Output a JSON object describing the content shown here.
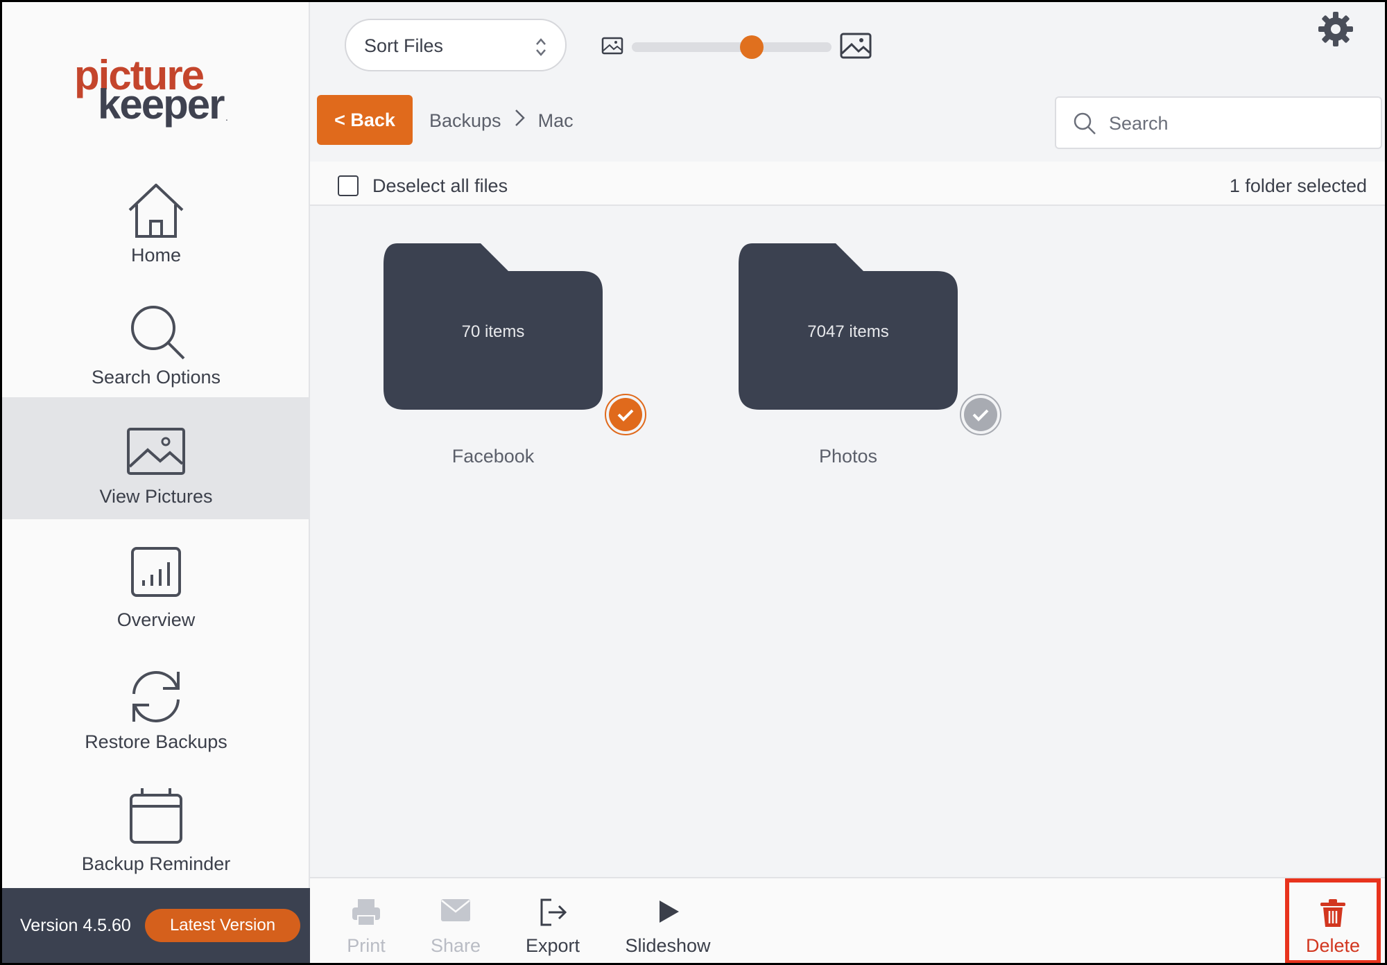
{
  "sidebar": {
    "logo": {
      "line1": "picture",
      "line2": "keeper",
      "mark": "."
    },
    "items": [
      {
        "label": "Home",
        "icon": "home-icon"
      },
      {
        "label": "Search Options",
        "icon": "search-icon"
      },
      {
        "label": "View Pictures",
        "icon": "picture-icon",
        "active": true
      },
      {
        "label": "Overview",
        "icon": "bar-chart-icon"
      },
      {
        "label": "Restore Backups",
        "icon": "refresh-icon"
      },
      {
        "label": "Backup Reminder",
        "icon": "calendar-icon"
      }
    ],
    "version": "Version 4.5.60",
    "latest_label": "Latest Version"
  },
  "toolbar": {
    "sort_label": "Sort Files",
    "thumbnail_size_fraction": 0.6,
    "settings_icon": "gear-icon"
  },
  "nav": {
    "back_label": "< Back",
    "breadcrumb": [
      "Backups",
      "Mac"
    ],
    "search_placeholder": "Search"
  },
  "selection": {
    "deselect_label": "Deselect all files",
    "selected_count": "1 folder selected"
  },
  "folders": [
    {
      "name": "Facebook",
      "count": "70 items",
      "selected": true
    },
    {
      "name": "Photos",
      "count": "7047 items",
      "selected": false
    }
  ],
  "bottom": {
    "print": "Print",
    "share": "Share",
    "export": "Export",
    "slideshow": "Slideshow",
    "delete": "Delete"
  },
  "colors": {
    "accent": "#e06a1c",
    "folder": "#3b4150",
    "delete_highlight": "#e8331d"
  }
}
